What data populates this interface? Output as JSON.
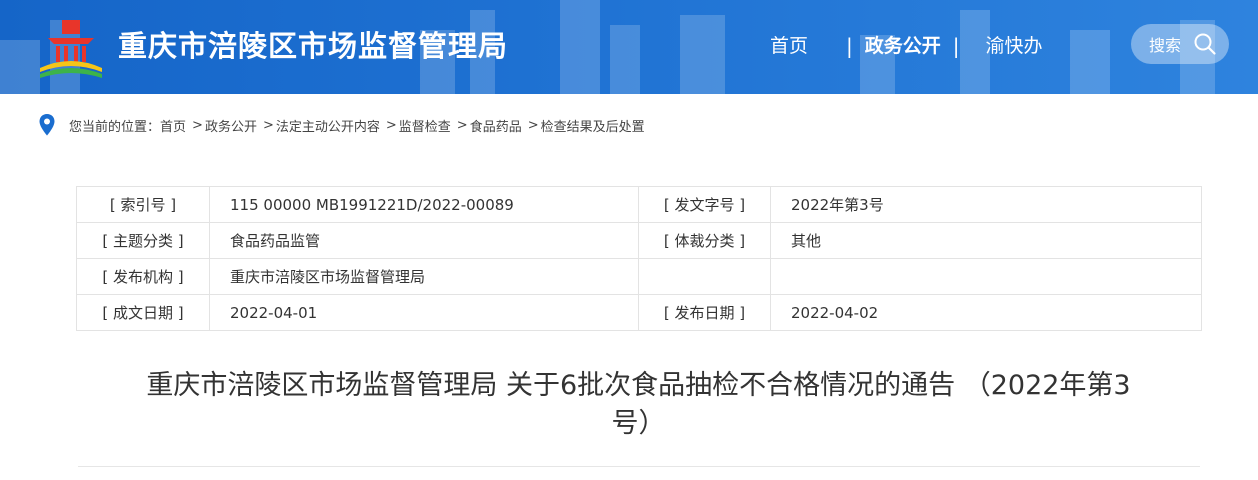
{
  "header": {
    "site_title": "重庆市涪陵区市场监督管理局",
    "nav": [
      {
        "label": "首页"
      },
      {
        "label": "政务公开"
      },
      {
        "label": "渝快办"
      }
    ],
    "nav_separator": "|",
    "search_label": "搜索",
    "colors": {
      "primary": "#1a6dcf",
      "text": "#ffffff"
    }
  },
  "breadcrumb": {
    "prefix": "您当前的位置：",
    "items": [
      "首页",
      "政务公开",
      "法定主动公开内容",
      "监督检查",
      "食品药品",
      "检查结果及后处置"
    ],
    "separator": ">"
  },
  "info": {
    "rows": [
      {
        "l1": "[ 索引号 ]",
        "v1": "115 00000 MB1991221D/2022-00089",
        "l2": "[ 发文字号 ]",
        "v2": "2022年第3号"
      },
      {
        "l1": "[ 主题分类 ]",
        "v1": "食品药品监管",
        "l2": "[ 体裁分类 ]",
        "v2": "其他"
      },
      {
        "l1": "[ 发布机构 ]",
        "v1": "重庆市涪陵区市场监督管理局",
        "l2": "",
        "v2": ""
      },
      {
        "l1": "[ 成文日期 ]",
        "v1": "2022-04-01",
        "l2": "[ 发布日期 ]",
        "v2": "2022-04-02"
      }
    ]
  },
  "article": {
    "title_line1": "重庆市涪陵区市场监督管理局 关于6批次食品抽检不合格情况的通告 （2022年第3",
    "title_line2": "号）"
  }
}
